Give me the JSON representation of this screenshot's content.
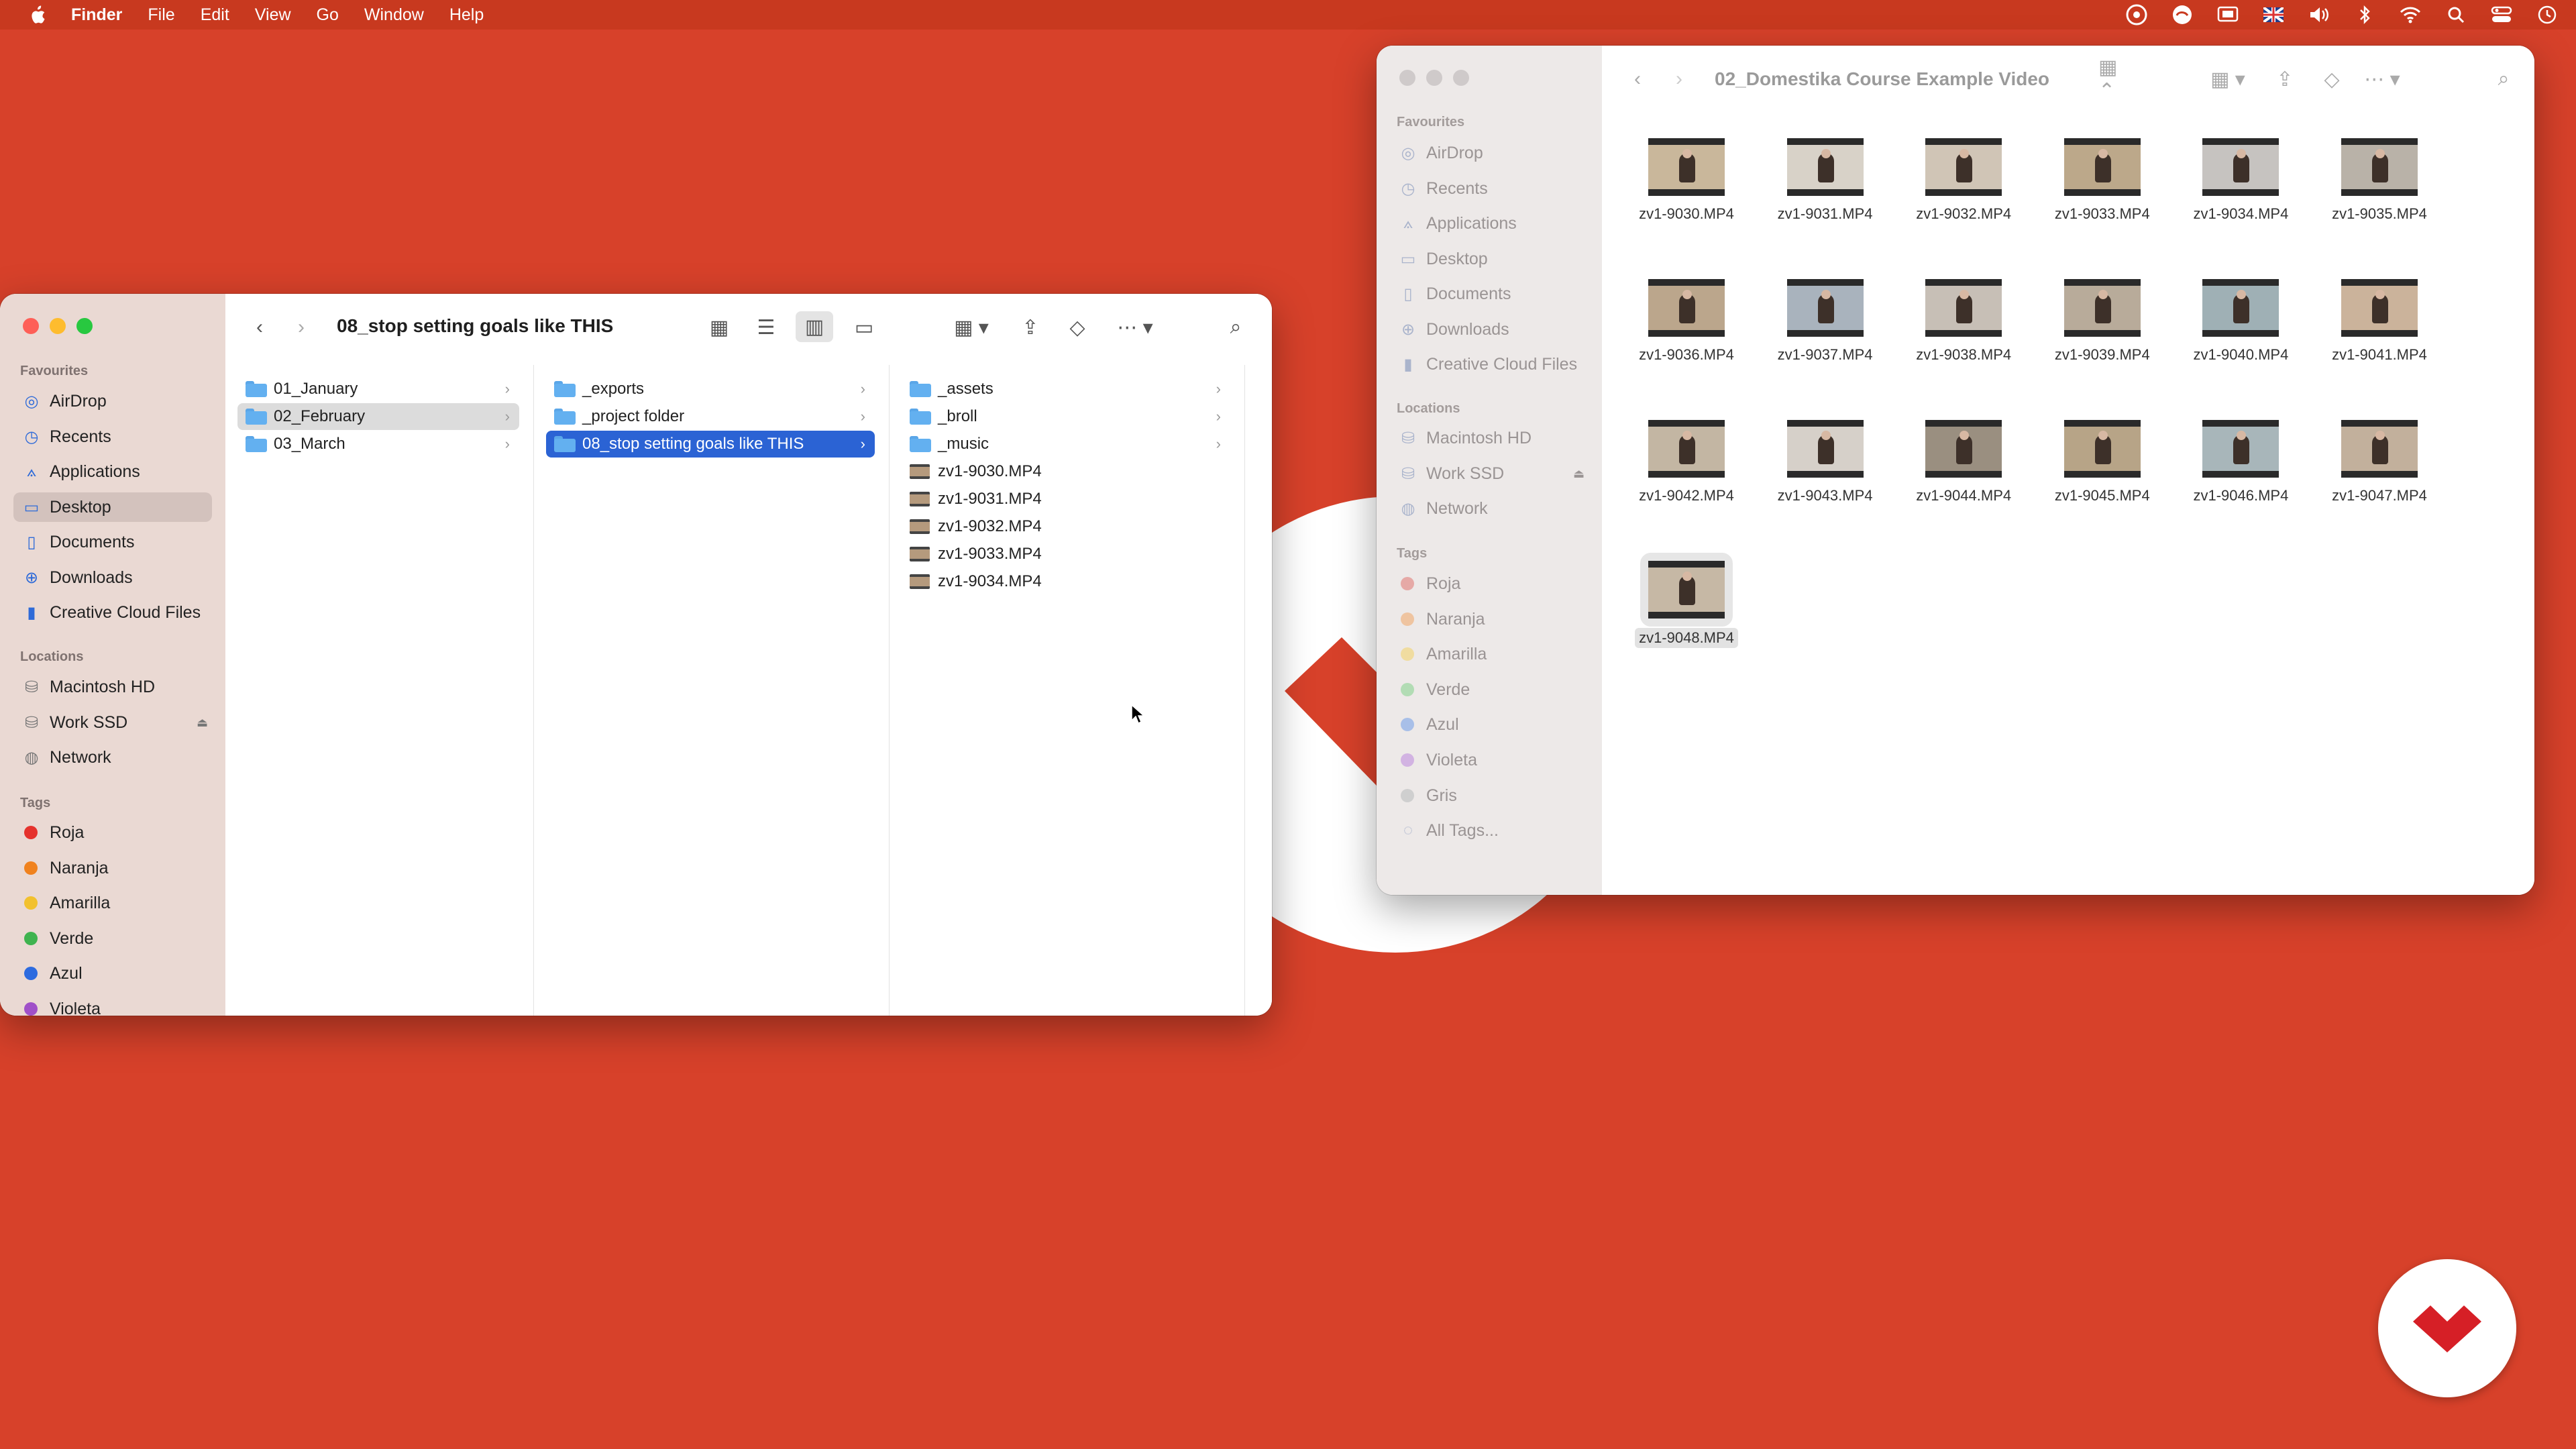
{
  "menubar": {
    "app_name": "Finder",
    "items": [
      "File",
      "Edit",
      "View",
      "Go",
      "Window",
      "Help"
    ],
    "status_icons": [
      "creative-cloud-icon",
      "adobe-sync-icon",
      "screen-mirroring-icon",
      "uk-flag-icon",
      "volume-icon",
      "bluetooth-icon",
      "wifi-icon",
      "spotlight-icon",
      "control-center-icon",
      "clock-icon"
    ]
  },
  "front_window": {
    "title": "08_stop setting goals like THIS",
    "sidebar": {
      "favourites_header": "Favourites",
      "favourites": [
        {
          "label": "AirDrop",
          "icon": "airdrop-icon"
        },
        {
          "label": "Recents",
          "icon": "clock-icon"
        },
        {
          "label": "Applications",
          "icon": "applications-icon"
        },
        {
          "label": "Desktop",
          "icon": "desktop-icon"
        },
        {
          "label": "Documents",
          "icon": "document-icon"
        },
        {
          "label": "Downloads",
          "icon": "download-icon"
        },
        {
          "label": "Creative Cloud Files",
          "icon": "file-icon"
        }
      ],
      "locations_header": "Locations",
      "locations": [
        {
          "label": "Macintosh HD",
          "icon": "disk-icon"
        },
        {
          "label": "Work SSD",
          "icon": "disk-icon"
        },
        {
          "label": "Network",
          "icon": "globe-icon"
        }
      ],
      "tags_header": "Tags",
      "tags": [
        {
          "label": "Roja",
          "color": "#e5322d"
        },
        {
          "label": "Naranja",
          "color": "#f0821e"
        },
        {
          "label": "Amarilla",
          "color": "#f2c12e"
        },
        {
          "label": "Verde",
          "color": "#3fb34f"
        },
        {
          "label": "Azul",
          "color": "#2d6bdf"
        },
        {
          "label": "Violeta",
          "color": "#a050c8"
        }
      ]
    },
    "columns": {
      "col1": [
        "01_January",
        "02_February",
        "03_March"
      ],
      "col2": [
        "_exports",
        "_project folder",
        "08_stop setting goals like THIS"
      ],
      "col3_folders": [
        "_assets",
        "_broll",
        "_music"
      ],
      "col3_files": [
        "zv1-9030.MP4",
        "zv1-9031.MP4",
        "zv1-9032.MP4",
        "zv1-9033.MP4",
        "zv1-9034.MP4"
      ]
    }
  },
  "back_window": {
    "title": "02_Domestika Course Example Video",
    "sidebar": {
      "favourites_header": "Favourites",
      "favourites": [
        "AirDrop",
        "Recents",
        "Applications",
        "Desktop",
        "Documents",
        "Downloads",
        "Creative Cloud Files"
      ],
      "locations_header": "Locations",
      "locations": [
        "Macintosh HD",
        "Work SSD",
        "Network"
      ],
      "tags_header": "Tags",
      "tags": [
        "Roja",
        "Naranja",
        "Amarilla",
        "Verde",
        "Azul",
        "Violeta",
        "Gris",
        "All Tags..."
      ]
    },
    "files": [
      "zv1-9030.MP4",
      "zv1-9031.MP4",
      "zv1-9032.MP4",
      "zv1-9033.MP4",
      "zv1-9034.MP4",
      "zv1-9035.MP4",
      "zv1-9036.MP4",
      "zv1-9037.MP4",
      "zv1-9038.MP4",
      "zv1-9039.MP4",
      "zv1-9040.MP4",
      "zv1-9041.MP4",
      "zv1-9042.MP4",
      "zv1-9043.MP4",
      "zv1-9044.MP4",
      "zv1-9045.MP4",
      "zv1-9046.MP4",
      "zv1-9047.MP4",
      "zv1-9048.MP4"
    ],
    "selected_file": "zv1-9048.MP4"
  },
  "colors": {
    "desktop": "#d7412a",
    "selection_blue": "#2b63d4"
  }
}
